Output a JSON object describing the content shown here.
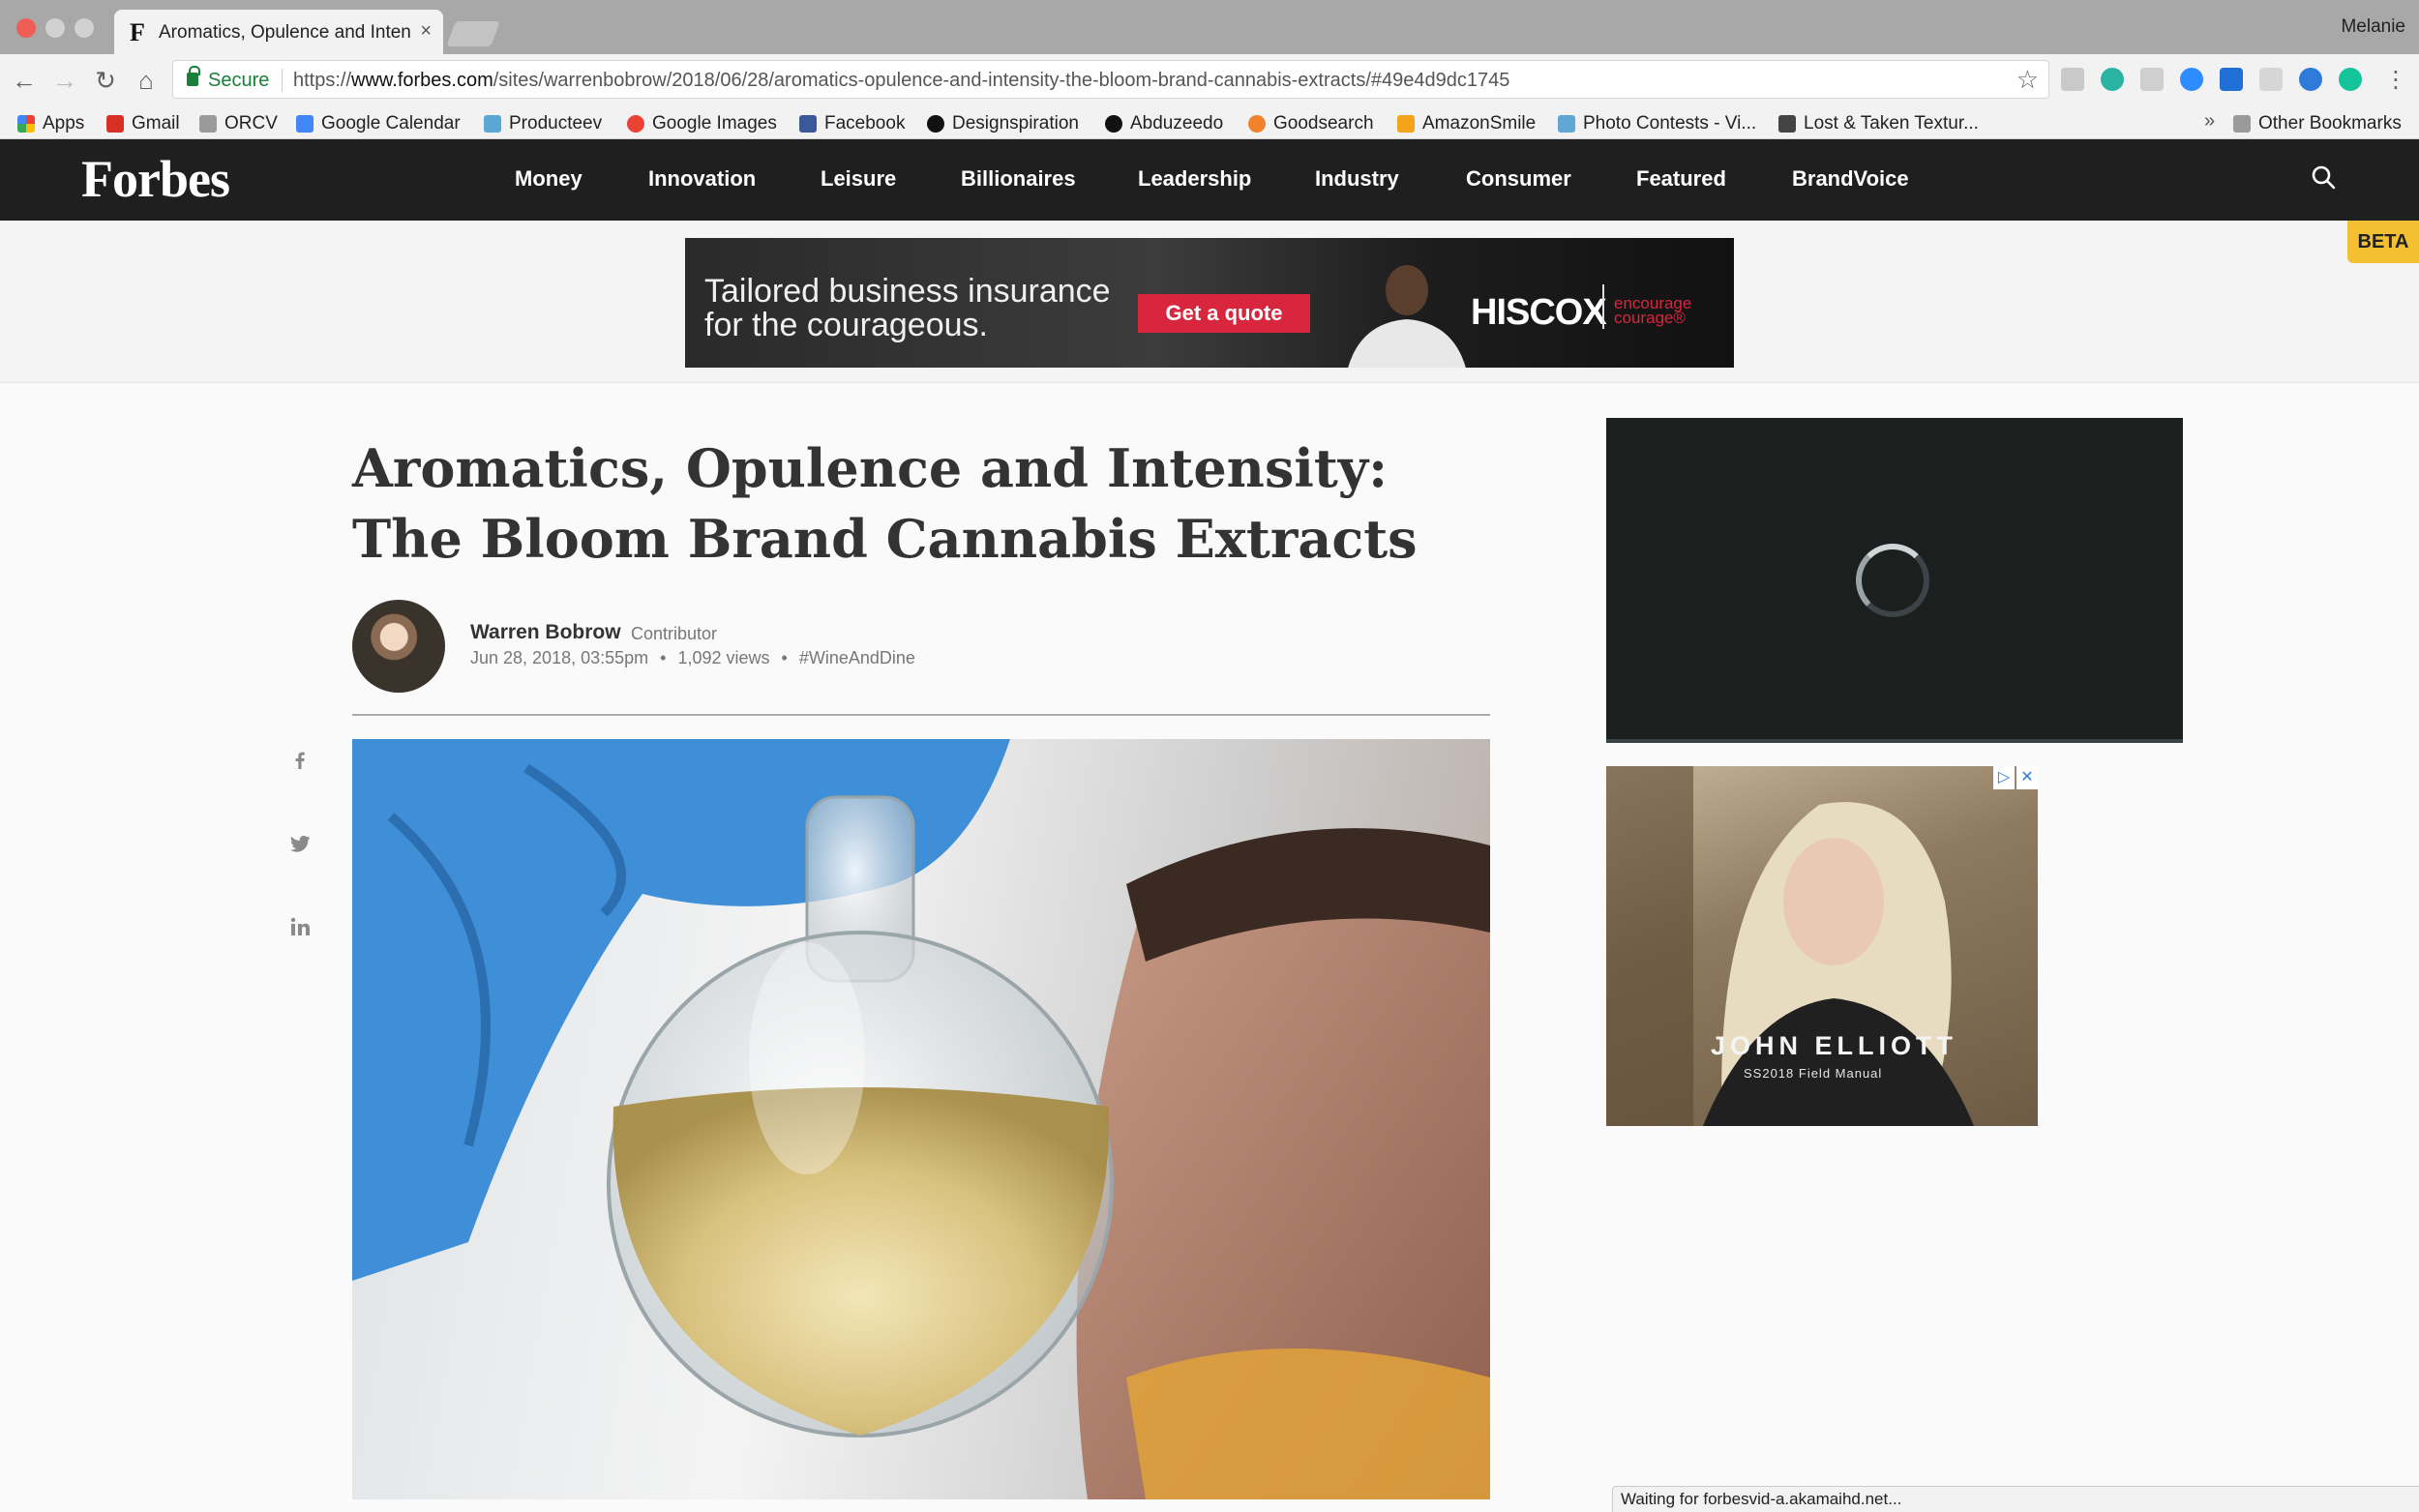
{
  "browser": {
    "tab_title": "Aromatics, Opulence and Intensity: The Bloom Brand Cannabis Extracts",
    "tab_favicon": "F",
    "profile": "Melanie",
    "secure_label": "Secure",
    "url_scheme": "https://",
    "url_host": "www.forbes.com",
    "url_path": "/sites/warrenbobrow/2018/06/28/aromatics-opulence-and-intensity-the-bloom-brand-cannabis-extracts/#49e4d9dc1745",
    "status_text": "Waiting for forbesvid-a.akamaihd.net..."
  },
  "bookmarks": [
    {
      "label": "Apps",
      "icon": "apps-grid-icon",
      "color": "#4285f4"
    },
    {
      "label": "Gmail",
      "icon": "gmail-icon",
      "color": "#d93025"
    },
    {
      "label": "ORCV",
      "icon": "folder-icon",
      "color": "#777777"
    },
    {
      "label": "Google Calendar",
      "icon": "calendar-icon",
      "color": "#4285f4"
    },
    {
      "label": "Producteev",
      "icon": "producteev-icon",
      "color": "#5aa7d6"
    },
    {
      "label": "Google Images",
      "icon": "google-icon",
      "color": "#ea4335"
    },
    {
      "label": "Facebook",
      "icon": "facebook-icon",
      "color": "#3b5998"
    },
    {
      "label": "Designspiration",
      "icon": "designspiration-icon",
      "color": "#111111"
    },
    {
      "label": "Abduzeedo",
      "icon": "abduzeedo-icon",
      "color": "#111111"
    },
    {
      "label": "Goodsearch",
      "icon": "heart-icon",
      "color": "#f0822e"
    },
    {
      "label": "AmazonSmile",
      "icon": "amazon-icon",
      "color": "#f3a41b"
    },
    {
      "label": "Photo Contests - Vi...",
      "icon": "viewbug-icon",
      "color": "#5fa8d3"
    },
    {
      "label": "Lost & Taken Textur...",
      "icon": "box-icon",
      "color": "#444444"
    }
  ],
  "other_bookmarks": "Other Bookmarks",
  "forbes": {
    "logo": "Forbes",
    "nav": [
      "Money",
      "Innovation",
      "Leisure",
      "Billionaires",
      "Leadership",
      "Industry",
      "Consumer",
      "Featured",
      "BrandVoice"
    ],
    "beta": "BETA"
  },
  "ad_banner": {
    "headline": "Tailored business insurance for the courageous.",
    "cta": "Get a quote",
    "brand": "HISCOX",
    "tagline": "encourage courage®"
  },
  "article": {
    "title": "Aromatics, Opulence and Intensity: The Bloom Brand Cannabis Extracts",
    "author": "Warren Bobrow",
    "role": "Contributor",
    "date": "Jun 28, 2018, 03:55pm",
    "views": "1,092 views",
    "tag": "#WineAndDine"
  },
  "side_ad": {
    "brand": "JOHN ELLIOTT",
    "sub": "SS2018   Field Manual"
  },
  "colors": {
    "nav_bg": "#1f1f1f",
    "beta": "#f3c033",
    "secure": "#188038",
    "cta": "#d7263d"
  }
}
